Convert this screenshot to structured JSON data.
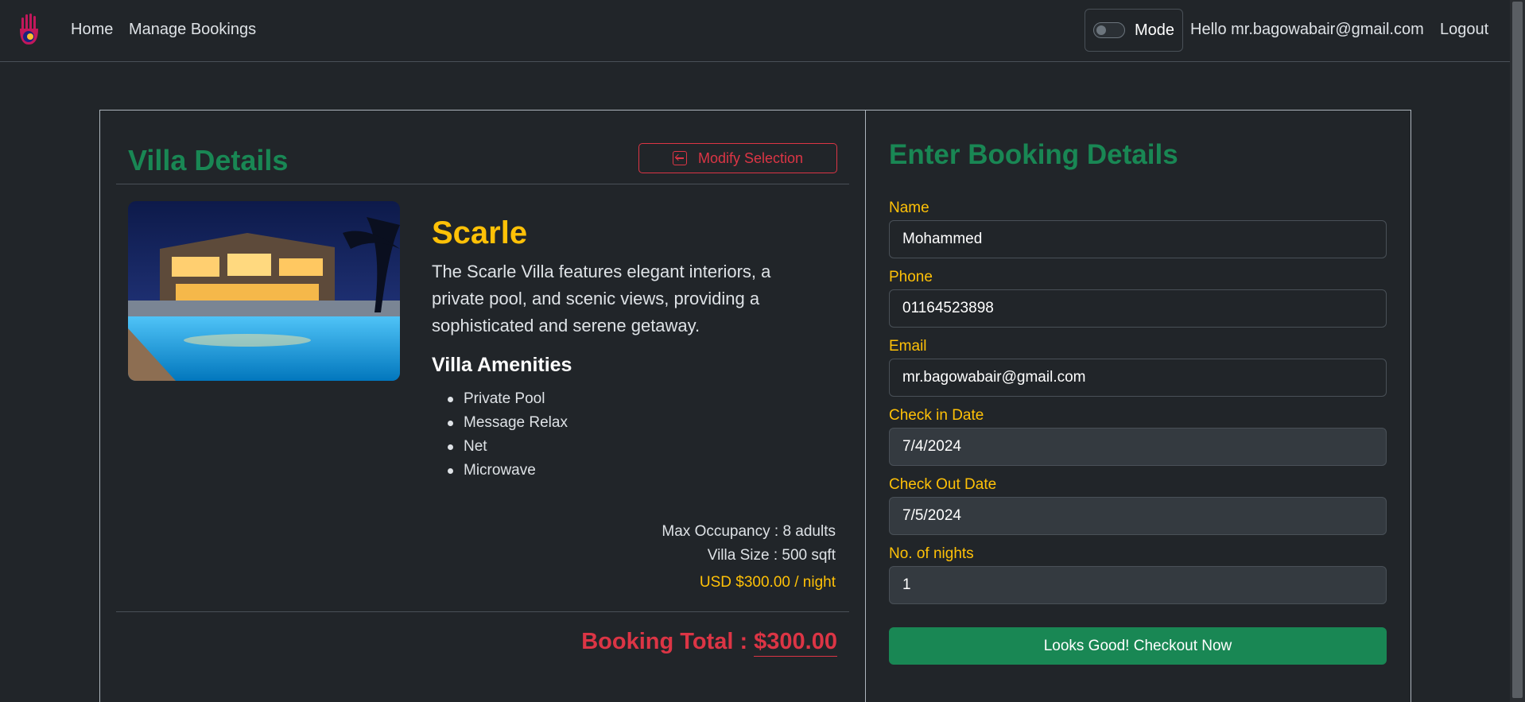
{
  "nav": {
    "home": "Home",
    "manage_bookings": "Manage Bookings",
    "mode_label": "Mode",
    "greeting": "Hello mr.bagowabair@gmail.com",
    "logout": "Logout"
  },
  "villa": {
    "section_title": "Villa Details",
    "modify_label": "Modify Selection",
    "name": "Scarle",
    "description": "The Scarle Villa features elegant interiors, a private pool, and scenic views, providing a sophisticated and serene getaway.",
    "amenities_title": "Villa Amenities",
    "amenities": [
      "Private Pool",
      "Message Relax",
      "Net",
      "Microwave"
    ],
    "occupancy": "Max Occupancy : 8 adults",
    "size": "Villa Size : 500 sqft",
    "price": "USD $300.00 / night",
    "total_label": "Booking Total : ",
    "total_amount": "$300.00"
  },
  "form": {
    "title": "Enter Booking Details",
    "name_label": "Name",
    "name_value": "Mohammed",
    "phone_label": "Phone",
    "phone_value": "01164523898",
    "email_label": "Email",
    "email_value": "mr.bagowabair@gmail.com",
    "checkin_label": "Check in Date",
    "checkin_value": "7/4/2024",
    "checkout_label": "Check Out Date",
    "checkout_value": "7/5/2024",
    "nights_label": "No. of nights",
    "nights_value": "1",
    "submit_label": "Looks Good! Checkout Now"
  },
  "colors": {
    "accent_green": "#198754",
    "accent_yellow": "#ffc107",
    "accent_red": "#dc3545"
  }
}
